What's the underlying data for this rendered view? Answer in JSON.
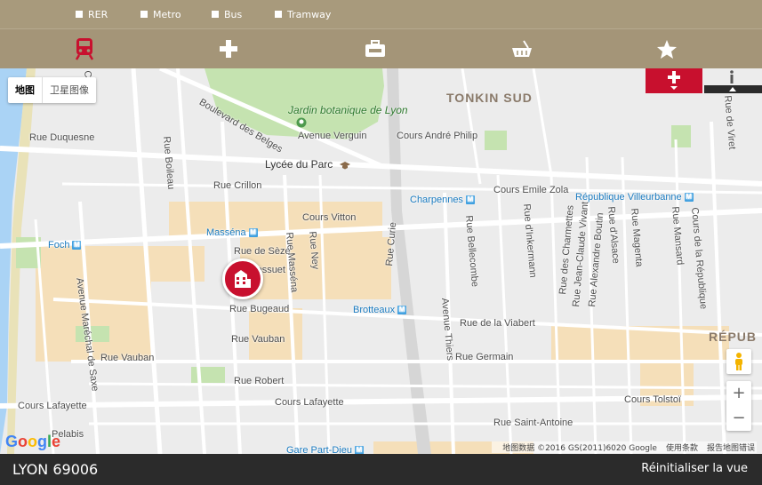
{
  "filters": [
    {
      "label": "RER"
    },
    {
      "label": "Metro"
    },
    {
      "label": "Bus"
    },
    {
      "label": "Tramway"
    }
  ],
  "categories": [
    {
      "icon": "train-icon",
      "active": true
    },
    {
      "icon": "medical-cross-icon",
      "active": false
    },
    {
      "icon": "toolbox-icon",
      "active": false
    },
    {
      "icon": "basket-icon",
      "active": false
    },
    {
      "icon": "star-icon",
      "active": false
    }
  ],
  "map": {
    "map_type": {
      "map": "地图",
      "satellite": "卫星图像"
    },
    "districts": {
      "tonkin": "TONKIN SUD",
      "republique": "RÉPUB"
    },
    "park": "Jardin botanique de Lyon",
    "poi": "Lycée du Parc",
    "metro_stations": {
      "charpennes": "Charpennes",
      "republique": "République Villeurbanne",
      "massena": "Masséna",
      "foch": "Foch",
      "brotteaux": "Brotteaux",
      "part_dieu": "Gare Part-Dieu"
    },
    "streets": {
      "duquesne": "Rue Duquesne",
      "belges": "Boulevard des Belges",
      "verguin": "Avenue Verguin",
      "andre_philip": "Cours André Philip",
      "crillon": "Rue Crillon",
      "vitton": "Cours Vitton",
      "emile_zola": "Cours Emile Zola",
      "seze": "Rue de Sèze",
      "bossuet": "Rue Bossuet",
      "bugeaud": "Rue Bugeaud",
      "vauban1": "Rue Vauban",
      "vauban2": "Rue Vauban",
      "robert": "Rue Robert",
      "lafayette1": "Cours Lafayette",
      "lafayette2": "Cours Lafayette",
      "viabert": "Rue de la Viabert",
      "germain": "Rue Germain",
      "saint_antoine": "Rue Saint-Antoine",
      "tolstoi": "Cours Tolstoï",
      "pelabis": "Pelabis",
      "crequi": "Créqui",
      "boileau": "Rue Boileau",
      "ney": "Rue Ney",
      "massena_street": "Rue Masséna",
      "curie": "Rue Curie",
      "bellecombe": "Rue Bellecombe",
      "inkermann": "Rue d'Inkermann",
      "charmettes": "Rue des Charmettes",
      "jean_claude_vivant": "Rue Jean-Claude Vivant",
      "alexandre_boutin": "Rue Alexandre Boutin",
      "alsace": "Rue d'Alsace",
      "magenta": "Rue Magenta",
      "mansard": "Rue Mansard",
      "republique_cours": "Cours de la République",
      "vitry": "Rue de Viret",
      "thiers": "Avenue Thiers",
      "marechal_saxe": "Avenue Maréchal de Saxe"
    },
    "google": "Google",
    "attribution": {
      "data": "地图数据 ©2016 GS(2011)6020 Google",
      "terms": "使用条款",
      "report": "报告地图错误"
    }
  },
  "footer": {
    "city": "LYON 69006",
    "reset": "Réinitialiser la vue"
  },
  "colors": {
    "header": "#a89a7c",
    "accent": "#c8102e",
    "footer": "#2b2b2b",
    "metro": "#3b9ee0"
  }
}
